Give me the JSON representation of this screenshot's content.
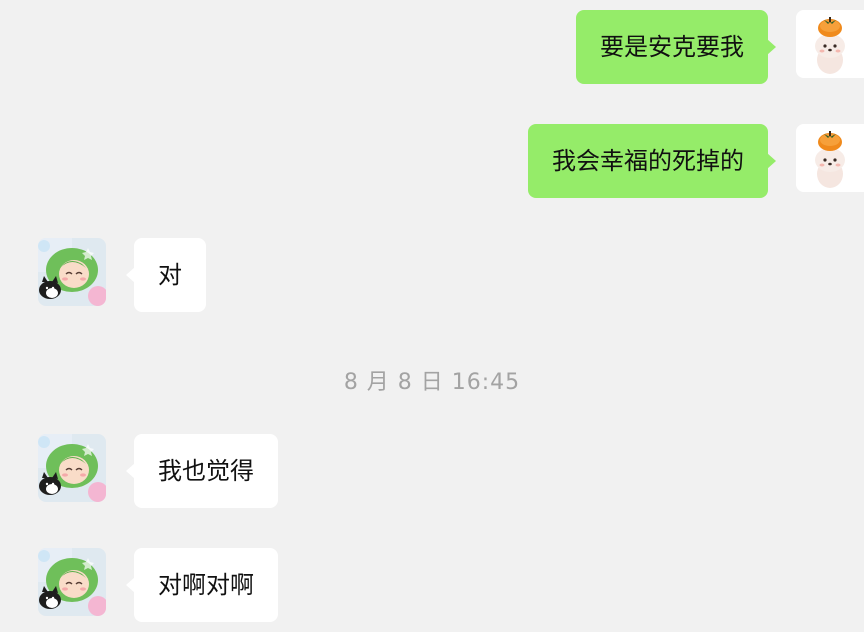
{
  "messages": [
    {
      "sender": "self",
      "text": "要是安克要我",
      "avatar": "persimmon-puppy-avatar"
    },
    {
      "sender": "self",
      "text": "我会幸福的死掉的",
      "avatar": "persimmon-puppy-avatar"
    },
    {
      "sender": "friend",
      "text": "对",
      "avatar": "green-hair-girl-cat-avatar"
    },
    {
      "sender": "friend",
      "text": "我也觉得",
      "avatar": "green-hair-girl-cat-avatar"
    },
    {
      "sender": "friend",
      "text": "对啊对啊",
      "avatar": "green-hair-girl-cat-avatar"
    }
  ],
  "timestamp": "8 月 8 日 16:45",
  "colors": {
    "background": "#f1f1f1",
    "outgoing_bubble": "#95ec69",
    "incoming_bubble": "#ffffff",
    "timestamp_text": "#a3a3a3"
  }
}
